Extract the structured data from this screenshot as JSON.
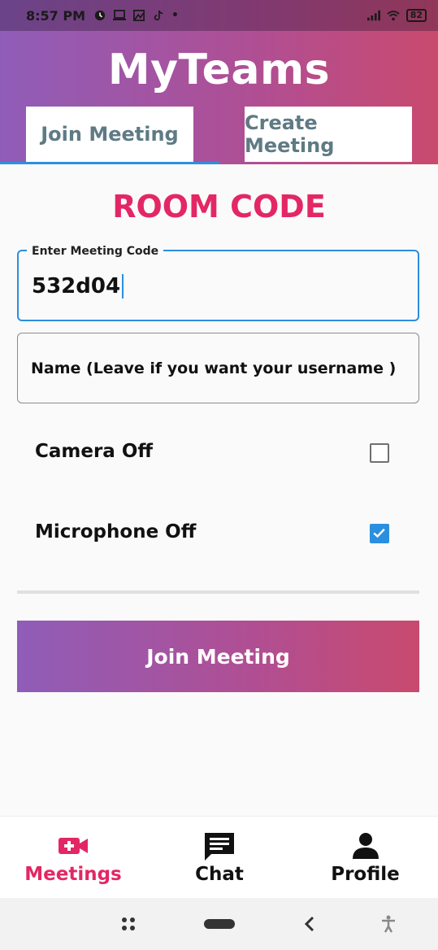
{
  "status_bar": {
    "time": "8:57 PM",
    "battery": "82"
  },
  "app": {
    "title": "MyTeams"
  },
  "tabs": [
    {
      "label": "Join Meeting",
      "active": true
    },
    {
      "label": "Create Meeting",
      "active": false
    }
  ],
  "section": {
    "heading": "ROOM CODE"
  },
  "meeting_code_field": {
    "label": "Enter Meeting Code",
    "value": "532d04"
  },
  "name_field": {
    "placeholder": "Name (Leave if you want your username )"
  },
  "options": [
    {
      "label": "Camera Off",
      "checked": false
    },
    {
      "label": "Microphone Off",
      "checked": true
    }
  ],
  "join_button": {
    "label": "Join Meeting"
  },
  "bottom_nav": [
    {
      "label": "Meetings",
      "icon": "video-add-icon",
      "active": true
    },
    {
      "label": "Chat",
      "icon": "chat-icon",
      "active": false
    },
    {
      "label": "Profile",
      "icon": "person-icon",
      "active": false
    }
  ],
  "colors": {
    "accent_pink": "#e32765",
    "accent_blue": "#2b8fe0",
    "gradient_start": "#8f5db8",
    "gradient_end": "#c94a6e",
    "tab_text": "#5f7a85"
  }
}
